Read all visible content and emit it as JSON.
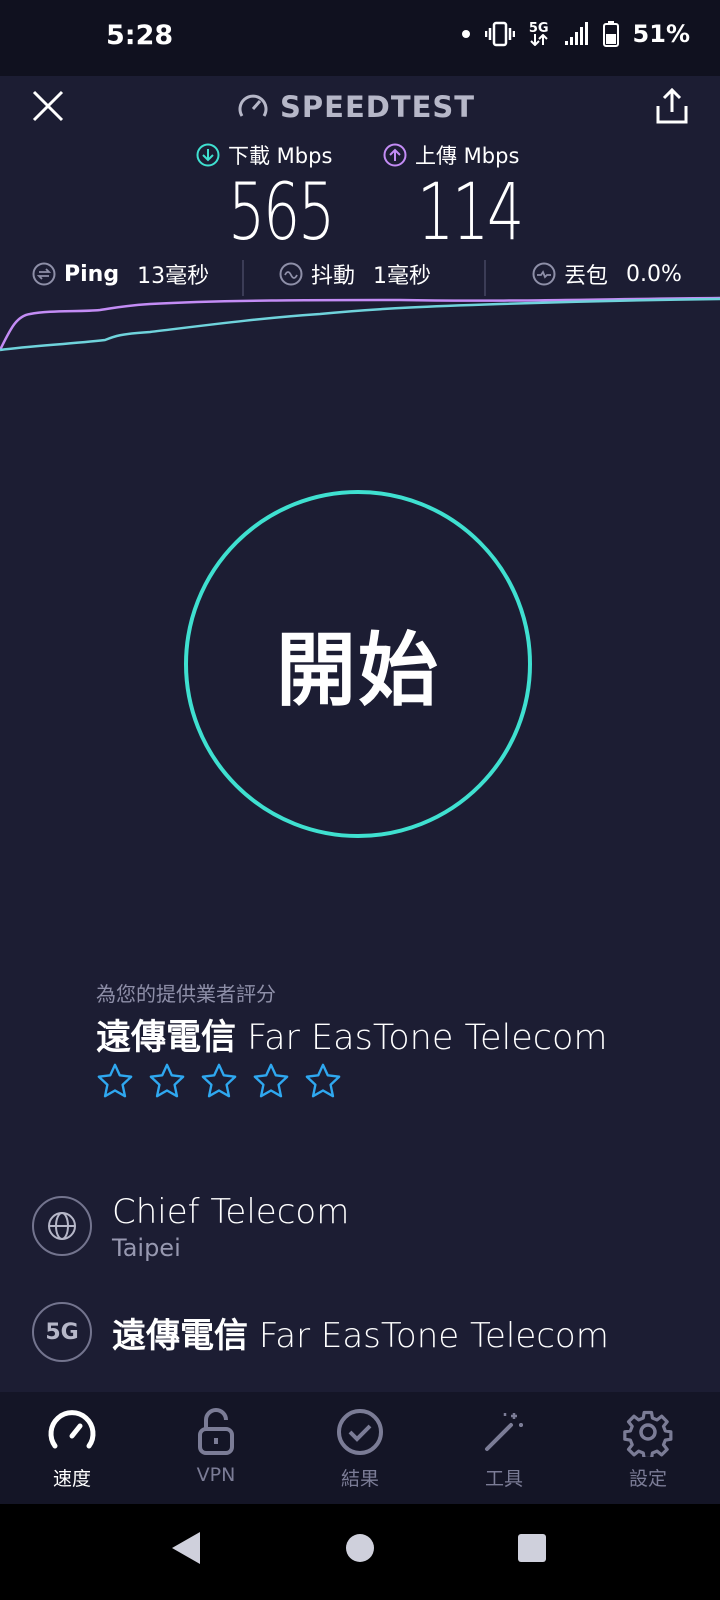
{
  "status": {
    "time": "5:28",
    "network": "5G",
    "battery": "51%"
  },
  "header": {
    "brand": "SPEEDTEST"
  },
  "download": {
    "label": "下載 Mbps",
    "value": "565",
    "color": "#3fe0d0"
  },
  "upload": {
    "label": "上傳 Mbps",
    "value": "114",
    "color": "#c38cf5"
  },
  "stats": {
    "ping": {
      "label": "Ping",
      "value": "13毫秒"
    },
    "jitter": {
      "label": "抖動",
      "value": "1毫秒"
    },
    "loss": {
      "label": "丟包",
      "value": "0.0%"
    }
  },
  "start_button": {
    "label": "開始"
  },
  "rating": {
    "caption": "為您的提供業者評分",
    "provider_zh": "遠傳電信",
    "provider_en": "Far EasTone Telecom",
    "stars": 5,
    "star_color": "#2fa8f0"
  },
  "server": {
    "name": "Chief Telecom",
    "location": "Taipei"
  },
  "provider": {
    "badge": "5G",
    "name_zh": "遠傳電信",
    "name_en": "Far EasTone Telecom"
  },
  "tabs": [
    {
      "label": "速度",
      "icon": "speedometer-icon",
      "active": true
    },
    {
      "label": "VPN",
      "icon": "unlock-icon",
      "active": false
    },
    {
      "label": "結果",
      "icon": "check-circle-icon",
      "active": false
    },
    {
      "label": "工具",
      "icon": "magic-wand-icon",
      "active": false
    },
    {
      "label": "設定",
      "icon": "gear-icon",
      "active": false
    }
  ]
}
